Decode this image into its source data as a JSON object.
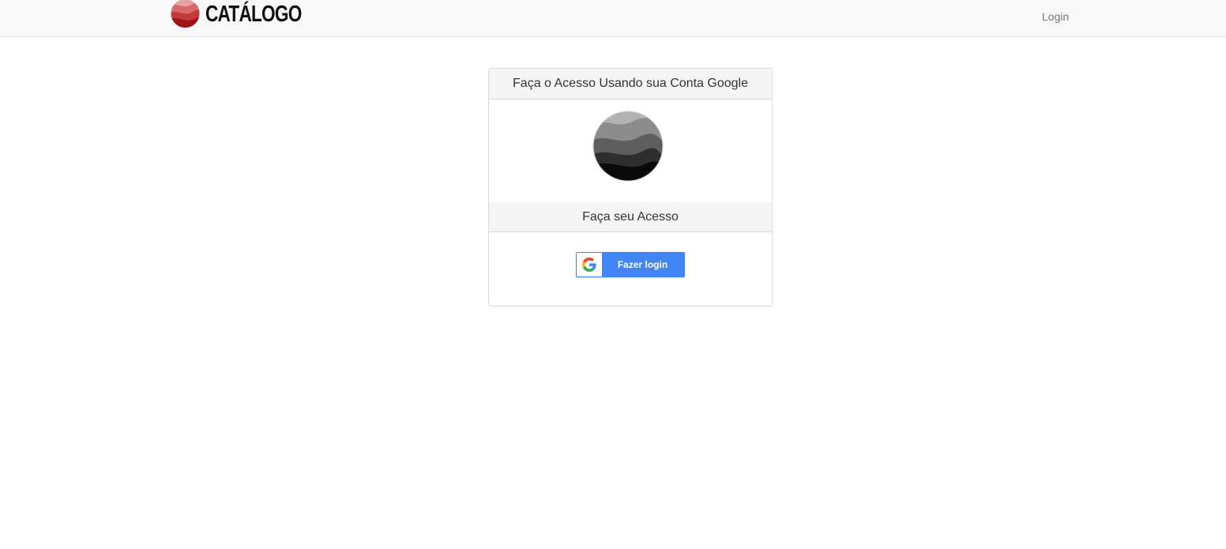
{
  "navbar": {
    "brand_text": "CATÁLOGO",
    "login_link": "Login"
  },
  "panel": {
    "heading": "Faça o Acesso Usando sua Conta Google",
    "sub_heading": "Faça seu Acesso",
    "google_button_label": "Fazer login"
  },
  "icons": {
    "brand_logo": "red-wave-circle-logo",
    "avatar": "grey-wave-circle-avatar",
    "google": "google-g-icon"
  },
  "colors": {
    "navbar_bg": "#f8f8f8",
    "google_blue": "#4285f4",
    "brand_red": "#b22222"
  }
}
